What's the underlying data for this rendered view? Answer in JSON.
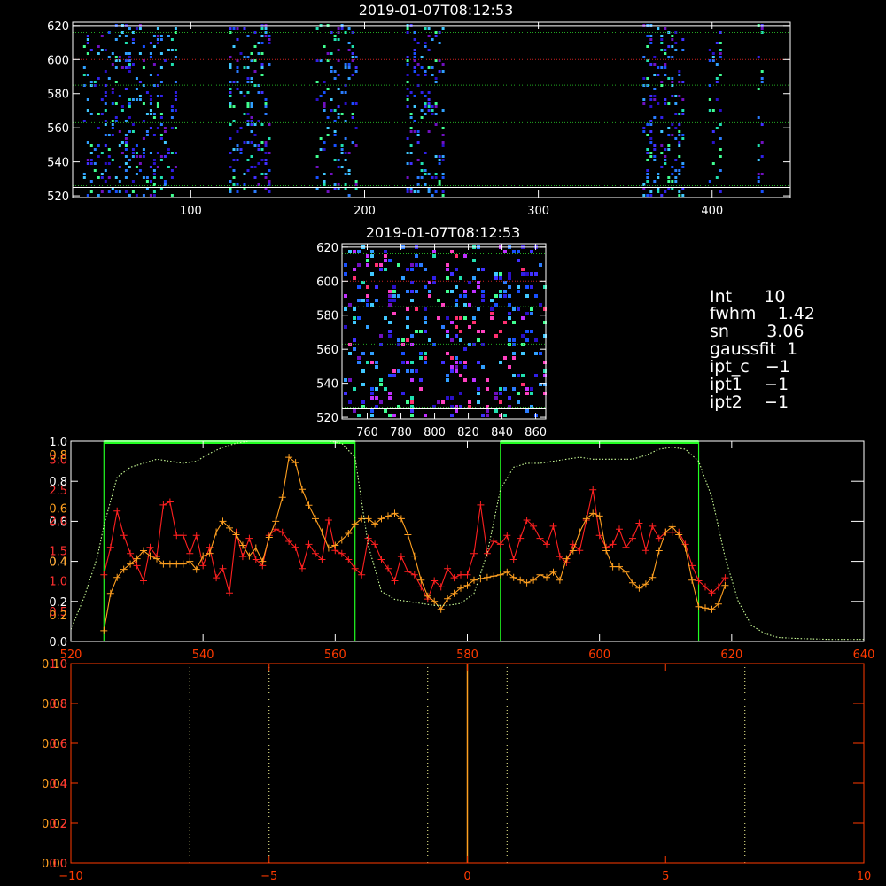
{
  "colors": {
    "background": "#000000",
    "axis_white": "#ffffff",
    "red_series": "#ff2020",
    "orange_series": "#ffa020",
    "green_box": "#22ff22",
    "dotted_profile": "#ccff99",
    "bottom_axis": "#ff3a00"
  },
  "chart_data": [
    {
      "type": "heatmap",
      "title": "2019-01-07T08:12:53",
      "xlim": [
        32,
        445
      ],
      "ylim": [
        519,
        622
      ],
      "xticks": [
        100,
        200,
        300,
        400
      ],
      "yticks": [
        520,
        540,
        560,
        580,
        600,
        620
      ],
      "bright_columns": [
        [
          38,
          60
        ],
        [
          60,
          92
        ],
        [
          122,
          146
        ],
        [
          172,
          196
        ],
        [
          224,
          246
        ],
        [
          360,
          384
        ],
        [
          398,
          406
        ],
        [
          426,
          430
        ]
      ],
      "hlines": [
        {
          "y": 620,
          "color": "#ffffff",
          "style": "solid"
        },
        {
          "y": 616,
          "color": "#22aa22",
          "style": "dotted"
        },
        {
          "y": 600,
          "color": "#cc2020",
          "style": "dotted"
        },
        {
          "y": 585,
          "color": "#22aa22",
          "style": "dotted"
        },
        {
          "y": 563,
          "color": "#22aa22",
          "style": "dotted"
        },
        {
          "y": 526,
          "color": "#22aa22",
          "style": "dotted"
        },
        {
          "y": 525,
          "color": "#ffffff",
          "style": "solid"
        }
      ]
    },
    {
      "type": "heatmap",
      "title": "2019-01-07T08:12:53",
      "xlim": [
        745,
        866
      ],
      "ylim": [
        519,
        622
      ],
      "xticks": [
        760,
        780,
        800,
        820,
        840,
        860
      ],
      "yticks": [
        520,
        540,
        560,
        580,
        600,
        620
      ],
      "hlines": [
        {
          "y": 620,
          "color": "#ffffff",
          "style": "solid"
        },
        {
          "y": 616,
          "color": "#22aa22",
          "style": "dotted"
        },
        {
          "y": 600,
          "color": "#cc2020",
          "style": "dotted"
        },
        {
          "y": 585,
          "color": "#22aa22",
          "style": "dotted"
        },
        {
          "y": 563,
          "color": "#22aa22",
          "style": "dotted"
        },
        {
          "y": 526,
          "color": "#22aa22",
          "style": "dotted"
        },
        {
          "y": 525,
          "color": "#ffffff",
          "style": "solid"
        }
      ]
    },
    {
      "type": "line",
      "xlim": [
        520,
        640
      ],
      "xticks": [
        520,
        540,
        560,
        580,
        600,
        620,
        640
      ],
      "left_white_ticks": [
        "0.0",
        "0.2",
        "0.4",
        "0.6",
        "0.8",
        "1.0"
      ],
      "left_white_tick_values": [
        0.0,
        0.2,
        0.4,
        0.6,
        0.8,
        1.0
      ],
      "left_red_ticks": [
        "0.5",
        "1.0",
        "1.5",
        "2.0",
        "2.5",
        "3.0"
      ],
      "left_red_tick_values": [
        0.5,
        1.0,
        1.5,
        2.0,
        2.5,
        3.0
      ],
      "left_red_range": [
        0,
        3.3
      ],
      "left_orange_ticks": [
        "0.2",
        "0.4",
        "0.6",
        "0.8"
      ],
      "left_orange_tick_values": [
        0.2,
        0.4,
        0.6,
        0.8
      ],
      "left_orange_range": [
        0.1,
        0.85
      ],
      "green_boxes": [
        [
          525,
          563
        ],
        [
          585,
          615
        ]
      ],
      "series": [
        {
          "color": "#ff2020",
          "x": [
            525,
            526,
            527,
            528,
            529,
            530,
            531,
            532,
            533,
            534,
            535,
            536,
            537,
            538,
            539,
            540,
            541,
            542,
            543,
            544,
            545,
            546,
            547,
            548,
            549,
            550,
            551,
            552,
            553,
            554,
            555,
            556,
            557,
            558,
            559,
            560,
            561,
            562,
            563,
            564,
            565,
            566,
            567,
            568,
            569,
            570,
            571,
            572,
            573,
            574,
            575,
            576,
            577,
            578,
            579,
            580,
            581,
            582,
            583,
            584,
            585,
            586,
            587,
            588,
            589,
            590,
            591,
            592,
            593,
            594,
            595,
            596,
            597,
            598,
            599,
            600,
            601,
            602,
            603,
            604,
            605,
            606,
            607,
            608,
            609,
            610,
            611,
            612,
            613,
            614,
            615,
            616,
            617,
            618,
            619
          ],
          "y": [
            1.1,
            1.55,
            2.15,
            1.75,
            1.45,
            1.25,
            1.0,
            1.55,
            1.4,
            2.25,
            2.3,
            1.75,
            1.75,
            1.45,
            1.75,
            1.25,
            1.55,
            1.05,
            1.2,
            0.8,
            1.8,
            1.4,
            1.7,
            1.35,
            1.25,
            1.75,
            1.85,
            1.8,
            1.65,
            1.55,
            1.2,
            1.6,
            1.45,
            1.35,
            2.0,
            1.5,
            1.45,
            1.35,
            1.2,
            1.1,
            1.7,
            1.6,
            1.35,
            1.2,
            1.0,
            1.4,
            1.15,
            1.1,
            0.9,
            0.7,
            1.0,
            0.9,
            1.2,
            1.05,
            1.1,
            1.1,
            1.45,
            2.25,
            1.45,
            1.65,
            1.6,
            1.75,
            1.35,
            1.7,
            2.0,
            1.9,
            1.7,
            1.6,
            1.9,
            1.4,
            1.3,
            1.6,
            1.5,
            2.0,
            2.5,
            1.75,
            1.55,
            1.6,
            1.85,
            1.55,
            1.7,
            1.95,
            1.5,
            1.9,
            1.7,
            1.8,
            1.8,
            1.8,
            1.6,
            1.25,
            1.0,
            0.9,
            0.8,
            0.9,
            1.05
          ],
          "y_range": [
            0,
            3.3
          ]
        },
        {
          "color": "#ffa020",
          "x": [
            525,
            526,
            527,
            528,
            529,
            530,
            531,
            532,
            533,
            534,
            535,
            536,
            537,
            538,
            539,
            540,
            541,
            542,
            543,
            544,
            545,
            546,
            547,
            548,
            549,
            550,
            551,
            552,
            553,
            554,
            555,
            556,
            557,
            558,
            559,
            560,
            561,
            562,
            563,
            564,
            565,
            566,
            567,
            568,
            569,
            570,
            571,
            572,
            573,
            574,
            575,
            576,
            577,
            578,
            579,
            580,
            581,
            582,
            583,
            584,
            585,
            586,
            587,
            588,
            589,
            590,
            591,
            592,
            593,
            594,
            595,
            596,
            597,
            598,
            599,
            600,
            601,
            602,
            603,
            604,
            605,
            606,
            607,
            608,
            609,
            610,
            611,
            612,
            613,
            614,
            615,
            616,
            617,
            618,
            619
          ],
          "y": [
            0.14,
            0.28,
            0.34,
            0.37,
            0.39,
            0.41,
            0.44,
            0.42,
            0.41,
            0.39,
            0.39,
            0.39,
            0.39,
            0.4,
            0.37,
            0.42,
            0.43,
            0.51,
            0.55,
            0.525,
            0.5,
            0.46,
            0.42,
            0.45,
            0.4,
            0.49,
            0.55,
            0.64,
            0.79,
            0.77,
            0.67,
            0.61,
            0.56,
            0.51,
            0.45,
            0.46,
            0.48,
            0.505,
            0.54,
            0.56,
            0.56,
            0.54,
            0.56,
            0.57,
            0.58,
            0.56,
            0.5,
            0.42,
            0.33,
            0.27,
            0.25,
            0.22,
            0.26,
            0.28,
            0.3,
            0.31,
            0.33,
            0.335,
            0.34,
            0.345,
            0.35,
            0.36,
            0.34,
            0.33,
            0.32,
            0.33,
            0.35,
            0.34,
            0.36,
            0.33,
            0.41,
            0.44,
            0.51,
            0.56,
            0.58,
            0.57,
            0.44,
            0.38,
            0.38,
            0.36,
            0.32,
            0.3,
            0.315,
            0.34,
            0.44,
            0.51,
            0.53,
            0.5,
            0.45,
            0.33,
            0.23,
            0.225,
            0.22,
            0.24,
            0.31
          ],
          "y_range": [
            0.1,
            0.85
          ]
        },
        {
          "color": "#ccff99",
          "style": "dotted",
          "x": [
            520,
            522,
            524,
            525,
            527,
            529,
            531,
            533,
            535,
            537,
            539,
            541,
            543,
            545,
            547,
            549,
            551,
            553,
            555,
            557,
            559,
            561,
            563,
            565,
            567,
            569,
            571,
            573,
            575,
            577,
            579,
            581,
            583,
            585,
            587,
            589,
            591,
            593,
            595,
            597,
            599,
            601,
            603,
            605,
            607,
            609,
            611,
            613,
            615,
            617,
            619,
            621,
            623,
            625,
            627,
            630,
            635,
            640
          ],
          "y": [
            0.06,
            0.22,
            0.42,
            0.58,
            0.82,
            0.87,
            0.89,
            0.91,
            0.9,
            0.89,
            0.9,
            0.94,
            0.97,
            0.99,
            1.0,
            1.0,
            1.0,
            1.0,
            1.0,
            1.0,
            1.0,
            0.99,
            0.92,
            0.48,
            0.25,
            0.21,
            0.2,
            0.19,
            0.18,
            0.18,
            0.19,
            0.24,
            0.44,
            0.76,
            0.87,
            0.89,
            0.89,
            0.9,
            0.91,
            0.92,
            0.91,
            0.91,
            0.91,
            0.91,
            0.93,
            0.96,
            0.97,
            0.96,
            0.9,
            0.72,
            0.42,
            0.2,
            0.08,
            0.04,
            0.02,
            0.015,
            0.01,
            0.01
          ],
          "y_range": [
            0,
            1.0
          ]
        }
      ]
    },
    {
      "type": "line",
      "xlim": [
        -10,
        10
      ],
      "xticks": [
        "−10",
        "−5",
        "0",
        "5",
        "10"
      ],
      "xtick_values": [
        -10,
        -5,
        0,
        5,
        10
      ],
      "left_orange_ticks": [
        "0.00",
        "0.02",
        "0.04",
        "0.06",
        "0.08",
        "0.10"
      ],
      "left_orange_tick_values": [
        0.0,
        0.02,
        0.04,
        0.06,
        0.08,
        0.1
      ],
      "left_red_ticks": [
        "0.0",
        "0.2",
        "0.4",
        "0.6",
        "0.8",
        "1.0"
      ],
      "left_red_tick_values": [
        0.0,
        0.2,
        0.4,
        0.6,
        0.8,
        1.0
      ],
      "ylim": [
        0,
        0.1
      ],
      "vlines_dotted": [
        -7,
        -5,
        -1,
        1,
        7
      ],
      "vline_solid": 0
    }
  ],
  "info_panel": {
    "line1": "Int      10",
    "line2": "fwhm    1.42",
    "line3": "sn       3.06",
    "line4": "gaussfit  1",
    "line5": "ipt_c   −1",
    "line6": "ipt1    −1",
    "line7": "ipt2    −1"
  }
}
